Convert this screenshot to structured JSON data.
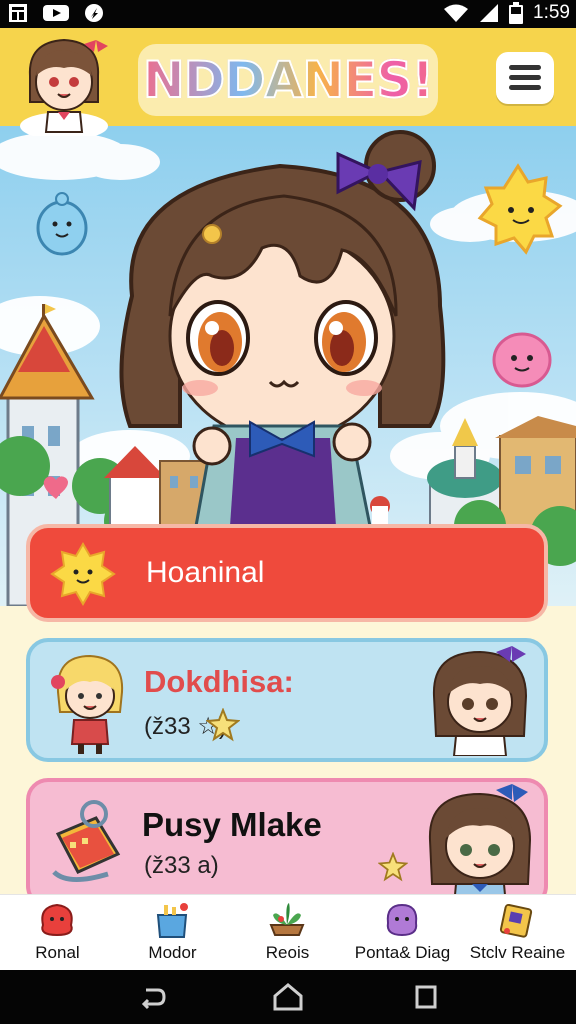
{
  "status_bar": {
    "time": "1:59",
    "icons": [
      "notification-icon",
      "youtube-icon",
      "app-icon",
      "wifi-icon",
      "signal-icon",
      "battery-icon"
    ]
  },
  "header": {
    "title": "NDDANES!",
    "menu_icon": "hamburger-icon"
  },
  "cards": [
    {
      "title": "Hoaninal",
      "icon": "sun-icon",
      "color": "#ef4a3c"
    },
    {
      "title": "Dokdhisa:",
      "subtitle": "(ž33 ☆)",
      "color": "#bfe3f2"
    },
    {
      "title": "Pusy Mlake",
      "subtitle": "(ž33 a)",
      "color": "#f6bcd2"
    }
  ],
  "tabs": [
    {
      "label": "Ronal",
      "icon": "red-blob-icon"
    },
    {
      "label": "Modor",
      "icon": "cup-icon"
    },
    {
      "label": "Reois",
      "icon": "plant-icon"
    },
    {
      "label": "Ponta& Diag",
      "icon": "purple-blob-icon"
    },
    {
      "label": "Stclv Reaine",
      "icon": "notebook-icon"
    }
  ],
  "nav": [
    "back-icon",
    "home-icon",
    "recents-icon"
  ]
}
